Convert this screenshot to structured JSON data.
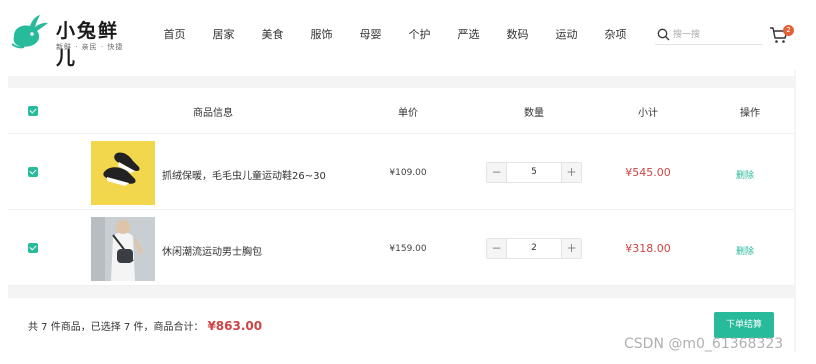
{
  "brand": {
    "title": "小兔鲜儿",
    "slogan": "新鲜 · 亲民 · 快捷"
  },
  "nav": [
    "首页",
    "居家",
    "美食",
    "服饰",
    "母婴",
    "个护",
    "严选",
    "数码",
    "运动",
    "杂项"
  ],
  "search": {
    "placeholder": "搜一搜"
  },
  "cart": {
    "badge": "2"
  },
  "table": {
    "headers": {
      "product": "商品信息",
      "price": "单价",
      "quantity": "数量",
      "subtotal": "小计",
      "action": "操作"
    },
    "rows": [
      {
        "name": "抓绒保暖，毛毛虫儿童运动鞋26~30",
        "price": "¥109.00",
        "quantity": "5",
        "subtotal": "¥545.00",
        "action": "删除",
        "minus": "−",
        "plus": "+"
      },
      {
        "name": "休闲潮流运动男士胸包",
        "price": "¥159.00",
        "quantity": "2",
        "subtotal": "¥318.00",
        "action": "删除",
        "minus": "−",
        "plus": "+"
      }
    ]
  },
  "footer": {
    "summary": "共 7 件商品，已选择 7 件，商品合计：",
    "total": "¥863.00",
    "checkout": "下单结算"
  },
  "watermark": "CSDN @m0_61368323",
  "colors": {
    "accent": "#27ba9b",
    "price_red": "#cf4444",
    "badge": "#e26237"
  }
}
